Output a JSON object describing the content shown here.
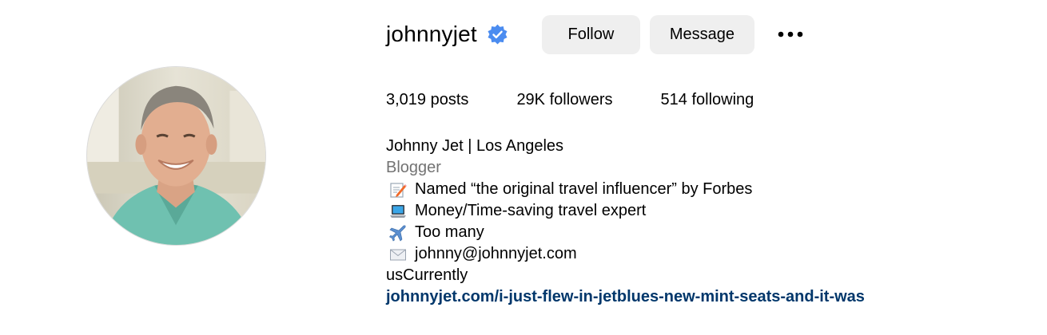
{
  "profile": {
    "username": "johnnyjet",
    "verified": true,
    "avatar_alt": "profile-photo"
  },
  "actions": {
    "follow_label": "Follow",
    "message_label": "Message",
    "more_icon": "more-options-icon"
  },
  "stats": {
    "posts_count": "3,019",
    "posts_label": "posts",
    "followers_count": "29K",
    "followers_label": "followers",
    "following_count": "514",
    "following_label": "following"
  },
  "bio": {
    "name": "Johnny Jet | Los Angeles",
    "category": "Blogger",
    "lines": [
      {
        "icon": "memo-icon",
        "text": "Named “the original travel influencer” by Forbes"
      },
      {
        "icon": "laptop-icon",
        "text": "Money/Time-saving travel expert"
      },
      {
        "icon": "airplane-icon",
        "text": "Too many"
      },
      {
        "icon": "envelope-icon",
        "text": "johnny@johnnyjet.com"
      }
    ],
    "extra": "usCurrently",
    "link": "johnnyjet.com/i-just-flew-in-jetblues-new-mint-seats-and-it-was"
  },
  "colors": {
    "button_bg": "#efefef",
    "verified_blue": "#4b8cf0",
    "link_blue": "#00376b",
    "secondary_text": "#737373"
  }
}
